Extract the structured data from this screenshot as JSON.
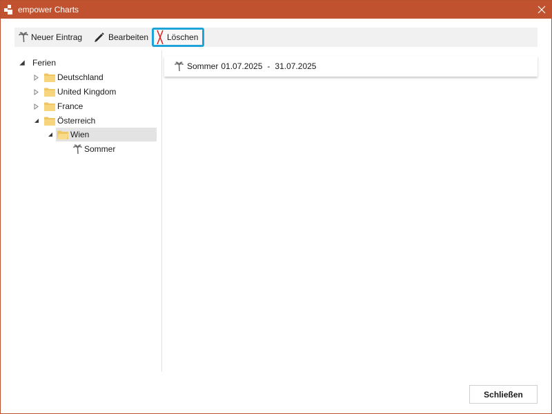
{
  "window": {
    "title": "empower Charts",
    "accent_color": "#c0522f"
  },
  "toolbar": {
    "new_entry_label": "Neuer Eintrag",
    "edit_label": "Bearbeiten",
    "delete_label": "Löschen",
    "selected_border_color": "#1ea4d8"
  },
  "tree": {
    "root": "Ferien",
    "items": [
      {
        "label": "Deutschland",
        "expanded": false
      },
      {
        "label": "United Kingdom",
        "expanded": false
      },
      {
        "label": "France",
        "expanded": false
      },
      {
        "label": "Österreich",
        "expanded": true
      }
    ],
    "city": {
      "label": "Wien",
      "selected": true
    },
    "leaf": {
      "label": "Sommer"
    }
  },
  "detail": {
    "entry_name": "Sommer",
    "start_date": "01.07.2025",
    "separator": "-",
    "end_date": "31.07.2025"
  },
  "footer": {
    "close_label": "Schließen"
  }
}
